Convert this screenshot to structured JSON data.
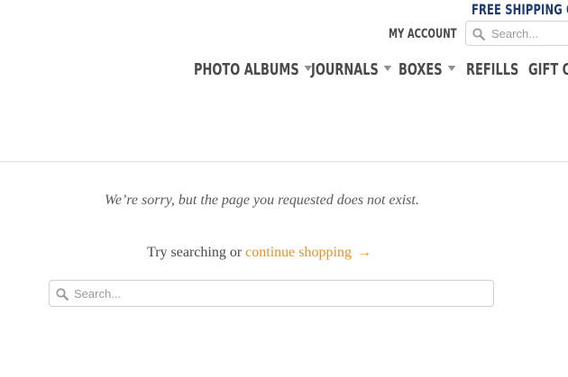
{
  "promo": {
    "text": "FREE SHIPPING ON"
  },
  "header": {
    "account_label": "MY ACCOUNT",
    "search_placeholder": "Search..."
  },
  "nav": {
    "items": [
      {
        "label": "PHOTO ALBUMS",
        "has_dropdown": true
      },
      {
        "label": "JOURNALS",
        "has_dropdown": true
      },
      {
        "label": "BOXES",
        "has_dropdown": true
      },
      {
        "label": "REFILLS",
        "has_dropdown": false
      },
      {
        "label": "GIFT CARDS",
        "has_dropdown": false
      }
    ]
  },
  "error": {
    "message": "We’re sorry, but the page you requested does not exist.",
    "try_prefix": "Try searching or",
    "continue_link": "continue shopping",
    "arrow": "→",
    "search_placeholder": "Search..."
  },
  "colors": {
    "link": "#e8912b",
    "promo": "#1f3a72",
    "nav_text": "#4a4a4a"
  },
  "icons": [
    "search-icon",
    "caret-down-icon",
    "arrow-right-icon"
  ]
}
